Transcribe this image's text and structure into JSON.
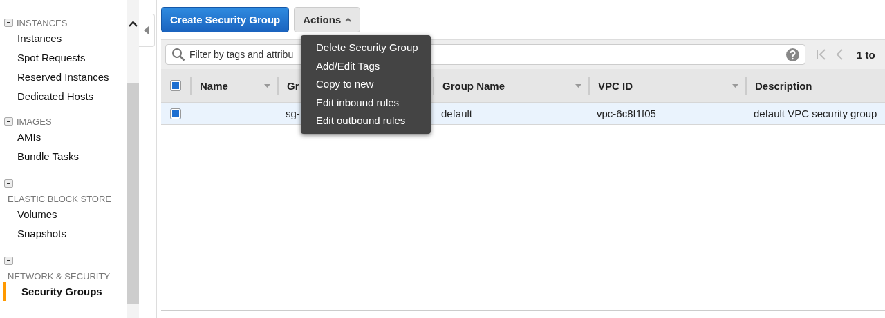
{
  "sidebar": {
    "sections": [
      {
        "title": "INSTANCES",
        "kind": "inline",
        "expanded": true,
        "items": [
          {
            "label": "Instances",
            "selected": false
          },
          {
            "label": "Spot Requests",
            "selected": false
          },
          {
            "label": "Reserved Instances",
            "selected": false
          },
          {
            "label": "Dedicated Hosts",
            "selected": false
          }
        ]
      },
      {
        "title": "IMAGES",
        "kind": "inline",
        "expanded": true,
        "items": [
          {
            "label": "AMIs",
            "selected": false
          },
          {
            "label": "Bundle Tasks",
            "selected": false
          }
        ]
      },
      {
        "title": "ELASTIC BLOCK STORE",
        "kind": "below",
        "expanded": true,
        "items": [
          {
            "label": "Volumes",
            "selected": false
          },
          {
            "label": "Snapshots",
            "selected": false
          }
        ]
      },
      {
        "title": "NETWORK & SECURITY",
        "kind": "below",
        "expanded": true,
        "items": [
          {
            "label": "Security Groups",
            "selected": true
          }
        ]
      }
    ]
  },
  "toolbar": {
    "create_button": "Create Security Group",
    "actions_button": "Actions",
    "actions_open": true
  },
  "actions_menu": [
    "Delete Security Group",
    "Add/Edit Tags",
    "Copy to new",
    "Edit inbound rules",
    "Edit outbound rules"
  ],
  "filter": {
    "placeholder": "Filter by tags and attribu"
  },
  "pagination": {
    "range": "1 to"
  },
  "table": {
    "header_checked": true,
    "columns": [
      "Name",
      "Gr",
      "Group Name",
      "VPC ID",
      "Description"
    ],
    "rows": [
      {
        "selected": true,
        "checked": true,
        "cells": [
          "",
          "sg-",
          "default",
          "vpc-6c8f1f05",
          "default VPC security group"
        ]
      }
    ]
  }
}
